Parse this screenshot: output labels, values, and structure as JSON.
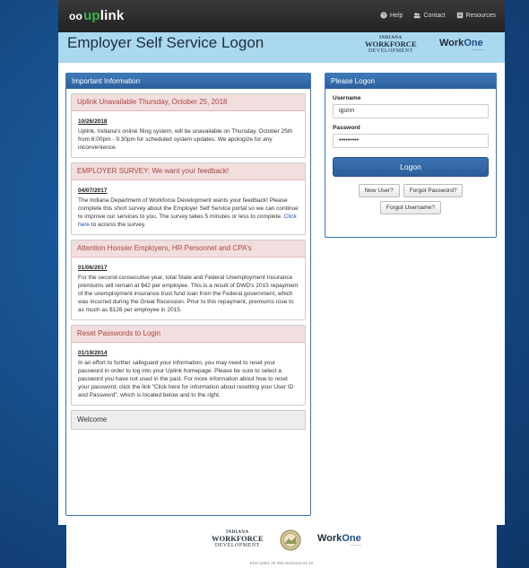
{
  "app": {
    "logo_prefix": "oo",
    "logo_up": "up",
    "logo_link": "link"
  },
  "topnav": {
    "help": "Help",
    "contact": "Contact",
    "resources": "Resources"
  },
  "header": {
    "title": "Employer Self Service Logon",
    "dwd_state": "INDIANA",
    "dwd_main": "WORKFORCE",
    "dwd_sub": "DEVELOPMENT",
    "workone_work": "Work",
    "workone_one": "One"
  },
  "info": {
    "heading": "Important Information",
    "items": [
      {
        "title": "Uplink Unavailable Thursday, October 25, 2018",
        "date": "10/26/2018",
        "text": "Uplink, Indiana's online filing system, will be unavailable on Thursday, October 25th from 6:00pm - 9:30pm for scheduled system updates. We apologize for any inconvenience."
      },
      {
        "title": "EMPLOYER SURVEY: We want your feedback!",
        "date": "04/07/2017",
        "text_before": "The Indiana Department of Workforce Development wants your feedback! Please complete this short survey about the Employer Self Service portal so we can continue to improve our services to you. The survey takes 5 minutes or less to complete. ",
        "link": "Click here",
        "text_after": " to access the survey."
      },
      {
        "title": "Attention Hoosier Employers, HR Personnel and CPA's",
        "date": "01/06/2017",
        "text": "For the second-consecutive year, total State and Federal Unemployment Insurance premiums will remain at $42 per employee. This is a result of DWD's 2015 repayment of the unemployment insurance trust fund loan from the Federal government, which was incurred during the Great Recession. Prior to this repayment, premiums rose to as much as $126 per employee in 2015."
      },
      {
        "title": "Reset Passwords to Login",
        "date": "01/19/2014",
        "text": "In an effort to further safeguard your information, you may need to reset your password in order to log into your Uplink homepage. Please be sure to select a password you have not used in the past. For more information about how to reset your password, click the link \"Click here for information about resetting your User ID and Password\", which is located below and to the right."
      }
    ],
    "welcome": "Welcome"
  },
  "login": {
    "heading": "Please Logon",
    "username_label": "Username",
    "username_value": "igunn",
    "password_label": "Password",
    "password_value": "•••••••••",
    "logon_button": "Logon",
    "new_user": "New User?",
    "forgot_password": "Forgot Password?",
    "forgot_username": "Forgot Username?"
  },
  "footer": {
    "version": "ESS UM01 26 266 20181110.01.10"
  }
}
